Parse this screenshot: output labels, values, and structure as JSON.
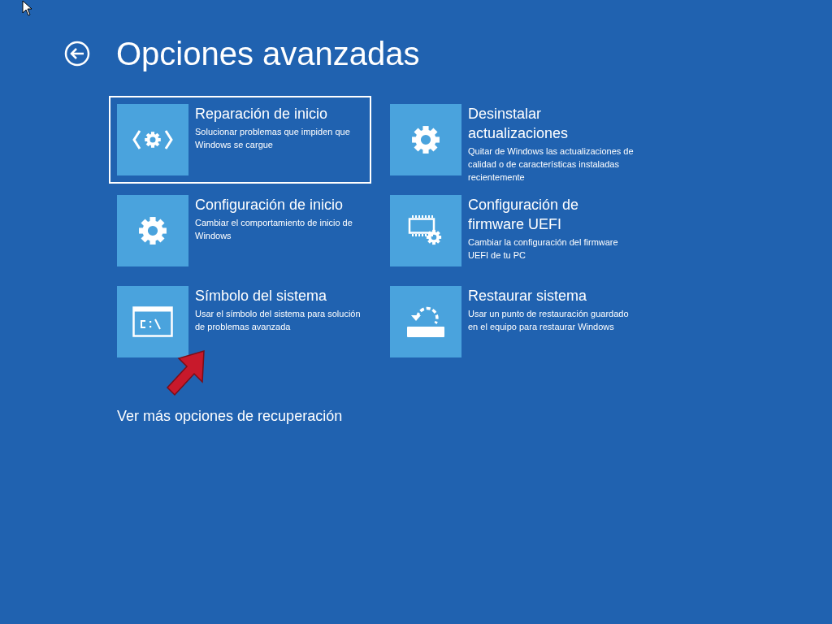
{
  "title": "Opciones avanzadas",
  "options": [
    {
      "kind": "repair",
      "title": "Reparación de inicio",
      "description": "Solucionar problemas que impiden que Windows se cargue",
      "selected": true
    },
    {
      "kind": "uninstall",
      "title": "Desinstalar actualizaciones",
      "description": "Quitar de Windows las actualizaciones de calidad o de características instaladas recientemente",
      "selected": false
    },
    {
      "kind": "startup",
      "title": "Configuración de inicio",
      "description": "Cambiar el comportamiento de inicio de Windows",
      "selected": false
    },
    {
      "kind": "firmware",
      "title": "Configuración de firmware UEFI",
      "description": "Cambiar la configuración del firmware UEFI de tu PC",
      "selected": false
    },
    {
      "kind": "cmd",
      "title": "Símbolo del sistema",
      "description": "Usar el símbolo del sistema para solución de problemas avanzada",
      "selected": false
    },
    {
      "kind": "restore",
      "title": "Restaurar sistema",
      "description": "Usar un punto de restauración guardado en el equipo para restaurar Windows",
      "selected": false
    }
  ],
  "more_link": "Ver más opciones de recuperación"
}
